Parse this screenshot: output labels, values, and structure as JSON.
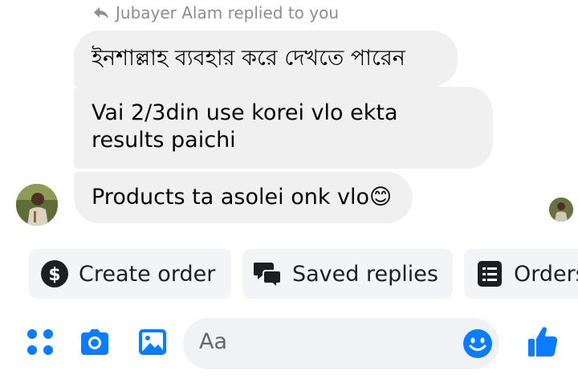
{
  "reply_header": {
    "text": "Jubayer Alam replied to you"
  },
  "messages": [
    {
      "text": "ইনশাল্লাহ ব্যবহার করে দেখতে পারেন"
    },
    {
      "text": "Vai 2/3din use korei vlo ekta results paichi"
    },
    {
      "text": "Products ta asolei onk vlo😊"
    }
  ],
  "quick_replies": [
    {
      "label": "Create order",
      "icon": "dollar-circle-icon"
    },
    {
      "label": "Saved replies",
      "icon": "chat-bubbles-icon"
    },
    {
      "label": "Orders",
      "icon": "list-icon"
    }
  ],
  "composer": {
    "placeholder": "Aa",
    "icons": [
      "apps-grid-icon",
      "camera-icon",
      "gallery-icon",
      "emoji-icon",
      "thumbs-up-icon"
    ]
  },
  "colors": {
    "accent": "#0a7cff",
    "bubble": "#f0f0f0",
    "chip": "#f2f4f7",
    "muted": "#8a8d91"
  }
}
